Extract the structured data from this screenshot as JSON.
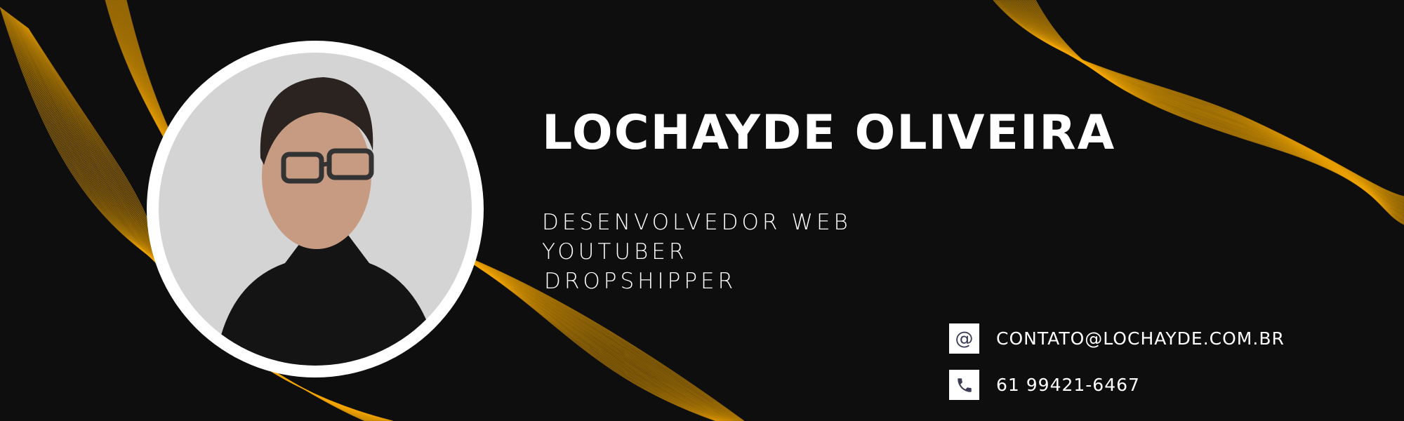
{
  "profile": {
    "name": "LOCHAYDE OLIVEIRA",
    "roles": [
      "DESENVOLVEDOR WEB",
      "YOUTUBER",
      "DROPSHIPPER"
    ]
  },
  "contacts": {
    "email": {
      "icon": "at-icon",
      "glyph": "@",
      "text": "CONTATO@LOCHAYDE.COM.BR"
    },
    "phone": {
      "icon": "phone-icon",
      "text": "61 99421-6467"
    }
  },
  "colors": {
    "background": "#0e0e0e",
    "accent": "#f5a800",
    "icon_color": "#3c3d55"
  }
}
